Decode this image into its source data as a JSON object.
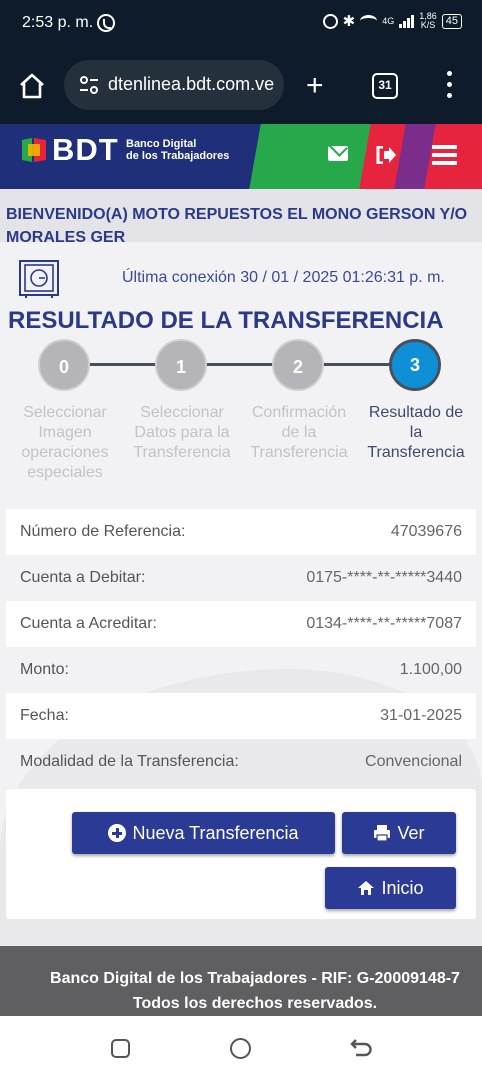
{
  "status_bar": {
    "time": "2:53 p. m.",
    "network": "4G",
    "speed_value": "1,86",
    "speed_unit": "K/S",
    "battery": "45"
  },
  "browser": {
    "url": "dtenlinea.bdt.com.ve",
    "tab_count": "31"
  },
  "header": {
    "logo_text": "BDT",
    "logo_line1": "Banco Digital",
    "logo_line2": "de los Trabajadores",
    "colors": {
      "navy": "#1f2f7a",
      "green": "#27a84a",
      "red": "#e6243e"
    }
  },
  "welcome": {
    "text": "BIENVENIDO(A) MOTO REPUESTOS EL MONO GERSON Y/O MORALES GER"
  },
  "last_connection": "Última conexión 30 / 01 / 2025 01:26:31 p. m.",
  "page_title": "RESULTADO DE LA TRANSFERENCIA",
  "steps": [
    {
      "number": "0",
      "label": "Seleccionar Imagen operaciones especiales",
      "active": false
    },
    {
      "number": "1",
      "label": "Seleccionar Datos para la Transferencia",
      "active": false
    },
    {
      "number": "2",
      "label": "Confirmación de la Transferencia",
      "active": false
    },
    {
      "number": "3",
      "label": "Resultado de la Transferencia",
      "active": true
    }
  ],
  "details": [
    {
      "label": "Número de Referencia:",
      "value": "47039676"
    },
    {
      "label": "Cuenta a Debitar:",
      "value": "0175-****-**-*****3440"
    },
    {
      "label": "Cuenta a Acreditar:",
      "value": "0134-****-**-*****7087"
    },
    {
      "label": "Monto:",
      "value": "1.100,00"
    },
    {
      "label": "Fecha:",
      "value": "31-01-2025"
    },
    {
      "label": "Modalidad de la Transferencia:",
      "value": "Convencional"
    }
  ],
  "actions": {
    "new_transfer": "Nueva Transferencia",
    "view": "Ver",
    "home": "Inicio"
  },
  "footer": {
    "line1": "Banco Digital de los Trabajadores - RIF: G-20009148-7",
    "line2": "Todos los derechos reservados."
  }
}
